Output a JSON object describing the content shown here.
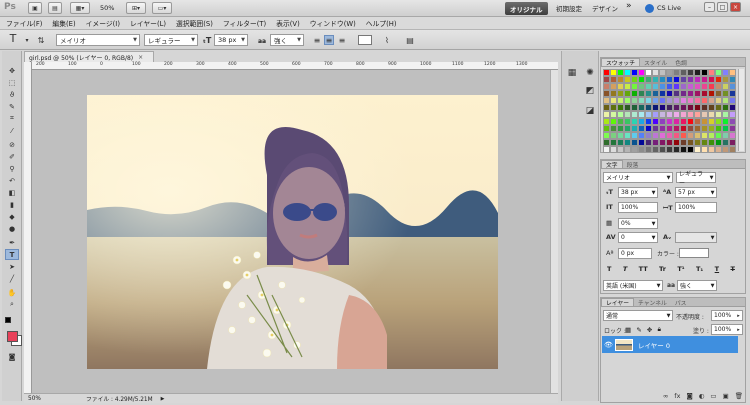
{
  "app": {
    "logo": "Ps",
    "zoom": "50%",
    "workspaces": {
      "active": "オリジナル",
      "reset": "初期設定",
      "design": "デザイン",
      "more": "»"
    },
    "cslive": "CS Live"
  },
  "menu": [
    "ファイル(F)",
    "編集(E)",
    "イメージ(I)",
    "レイヤー(L)",
    "選択範囲(S)",
    "フィルター(T)",
    "表示(V)",
    "ウィンドウ(W)",
    "ヘルプ(H)"
  ],
  "options": {
    "font_family": "メイリオ",
    "font_style": "レギュラー",
    "font_size": "38 px",
    "aa_label": "aa",
    "antialias": "強く"
  },
  "document": {
    "tab_title": "girl.psd @ 50% (レイヤー 0, RGB/8)",
    "close": "×",
    "zoom": "50%",
    "file_info": "ファイル : 4.29M/5.21M"
  },
  "ruler_ticks": [
    "200",
    "100",
    "0",
    "100",
    "200",
    "300",
    "400",
    "500",
    "600",
    "700",
    "800",
    "900",
    "1000",
    "1100",
    "1200",
    "1300"
  ],
  "swatches": {
    "tabs": [
      "スウォッチ",
      "スタイル",
      "色調"
    ]
  },
  "character": {
    "tabs": [
      "文字",
      "段落"
    ],
    "font_family": "メイリオ",
    "font_style": "レギュラー",
    "size": "38 px",
    "leading": "57 px",
    "v_scale": "100%",
    "h_scale": "100%",
    "tsume": "0%",
    "tracking": "0",
    "kerning": "",
    "baseline": "0 px",
    "color_label": "カラー :",
    "style_buttons": [
      "T",
      "T",
      "TT",
      "Tr",
      "T¹",
      "T₁",
      "T",
      "T"
    ],
    "language": "英語 (米国)",
    "aa_label": "aa",
    "antialias": "強く"
  },
  "layers": {
    "tabs": [
      "レイヤー",
      "チャンネル",
      "パス"
    ],
    "blend": "通常",
    "opacity_label": "不透明度 :",
    "opacity": "100%",
    "lock_label": "ロック :",
    "fill_label": "塗り :",
    "fill": "100%",
    "layer_name": "レイヤー 0"
  },
  "colors": {
    "accent": "#3f8fdf",
    "foreground": "#e8415a",
    "background": "#ffffff"
  }
}
